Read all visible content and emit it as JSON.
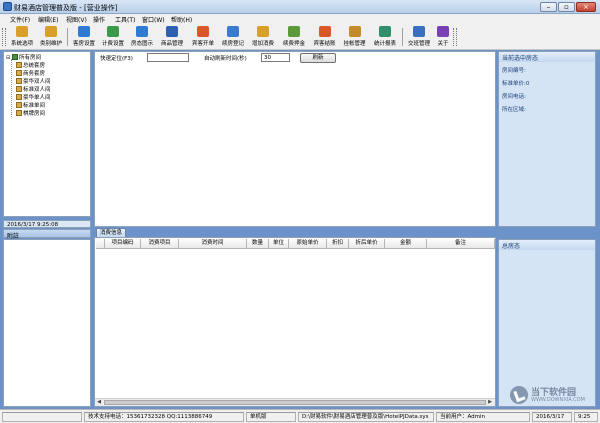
{
  "window": {
    "title": "财易酒店管理普及版 - [营业操作]",
    "buttons": {
      "minimize": "–",
      "restore": "▫",
      "close": "×"
    }
  },
  "menu": [
    "文件(F)",
    "编辑(E)",
    "视图(V)",
    "操作",
    "工具(T)",
    "窗口(W)",
    "帮助(H)"
  ],
  "toolbar": [
    {
      "label": "系统选项",
      "icon": "gear-icon",
      "color": "#d8a02a"
    },
    {
      "label": "类别维护",
      "icon": "category-icon",
      "color": "#d8a02a"
    },
    {
      "label": "客房设置",
      "icon": "room-settings-icon",
      "color": "#2e7bd1"
    },
    {
      "label": "计费设置",
      "icon": "billing-settings-icon",
      "color": "#3a9a4a"
    },
    {
      "label": "房态图示",
      "icon": "room-status-icon",
      "color": "#2e7bd1"
    },
    {
      "label": "商品管理",
      "icon": "goods-icon",
      "color": "#2e5fb0"
    },
    {
      "label": "宾客开单",
      "icon": "open-order-icon",
      "color": "#d9582a"
    },
    {
      "label": "续房登记",
      "icon": "extend-stay-icon",
      "color": "#3a7bd1"
    },
    {
      "label": "增加消费",
      "icon": "add-consumption-icon",
      "color": "#d8a02a"
    },
    {
      "label": "续费押金",
      "icon": "deposit-icon",
      "color": "#5a9a3a"
    },
    {
      "label": "宾客结账",
      "icon": "checkout-icon",
      "color": "#d9582a"
    },
    {
      "label": "挂帐管理",
      "icon": "credit-account-icon",
      "color": "#c28a2a"
    },
    {
      "label": "统计报表",
      "icon": "report-icon",
      "color": "#2e8f6a"
    },
    {
      "label": "交班管理",
      "icon": "shift-handover-icon",
      "color": "#3a6fc0"
    },
    {
      "label": "关于",
      "icon": "help-icon",
      "color": "#7b3fb5"
    }
  ],
  "tree": {
    "root": "所有房间",
    "floors": [
      {
        "name": "总统套房",
        "rooms": []
      },
      {
        "name": "商务套房",
        "rooms": []
      },
      {
        "name": "豪华双人间",
        "rooms": []
      },
      {
        "name": "标准双人间",
        "rooms": []
      },
      {
        "name": "豪华单人间",
        "rooms": []
      },
      {
        "name": "标准单间",
        "rooms": []
      },
      {
        "name": "棋牌房间",
        "rooms": []
      }
    ]
  },
  "left": {
    "datetime": "2016/3/17 9:25:08",
    "remark_header": "附註"
  },
  "filters": {
    "quick_locate_label": "快速定位(F3)",
    "quick_locate_value": "",
    "auto_refresh_label": "自动刷新时间(秒)",
    "auto_refresh_value": "30",
    "refresh_button": "刷新"
  },
  "tabs": [
    {
      "label": "消费信息",
      "active": true
    }
  ],
  "grid": {
    "columns": [
      "项目编码",
      "消费项目",
      "消费时间",
      "数量",
      "单位",
      "原始单价",
      "折扣",
      "折后单价",
      "金额",
      "备注"
    ],
    "rows": []
  },
  "right_panel": {
    "header": "当前选中房态",
    "items": [
      "房间编号:",
      "标准单价:0",
      "房间电话:",
      "所在区域:"
    ],
    "bottom_header": "总房态"
  },
  "status": {
    "blank": "",
    "support": "技术支持电话：15361732328 QQ:1113886749",
    "edition": "单机版",
    "path": "D:\\财易软件\\财易酒店管理普及版\\HotelPJData.sys",
    "user": "当前用户：Admin",
    "date": "2016/3/17",
    "time": "9:25"
  },
  "watermark": {
    "title": "当下软件园",
    "url": "WWW.DOWNXIA.COM"
  }
}
